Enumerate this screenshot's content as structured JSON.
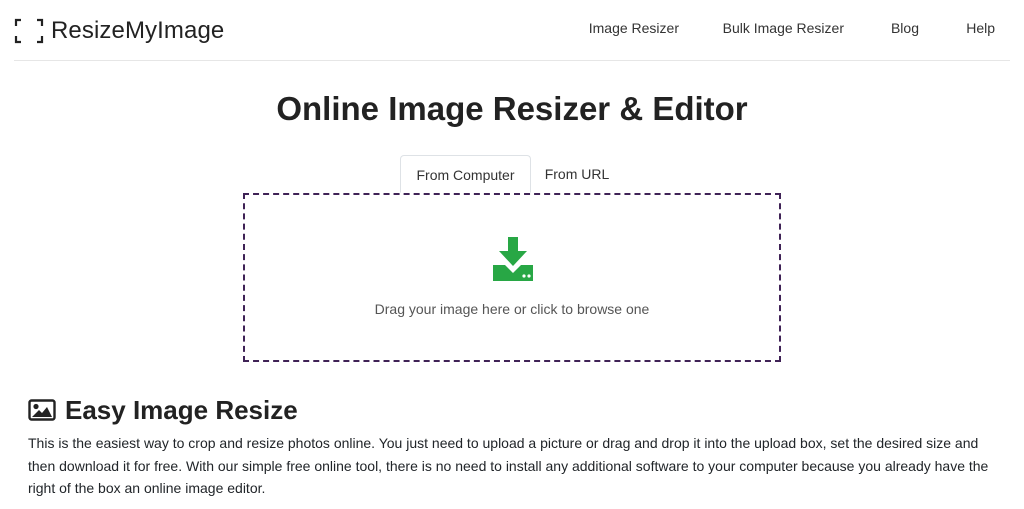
{
  "brand": {
    "name": "ResizeMyImage",
    "icon": "crop-corners-icon"
  },
  "nav": {
    "items": [
      {
        "label": "Image Resizer"
      },
      {
        "label": "Bulk Image Resizer"
      },
      {
        "label": "Blog"
      },
      {
        "label": "Help"
      }
    ]
  },
  "main": {
    "title": "Online Image Resizer & Editor",
    "tabs": [
      {
        "label": "From Computer",
        "active": true
      },
      {
        "label": "From URL",
        "active": false
      }
    ],
    "dropzone": {
      "icon": "download-tray-icon",
      "text": "Drag your image here or click to browse one"
    }
  },
  "section": {
    "icon": "image-icon",
    "title": "Easy Image Resize",
    "body": "This is the easiest way to crop and resize photos online. You just need to upload a picture or drag and drop it into the upload box, set the desired size and then download it for free. With our simple free online tool, there is no need to install any additional software to your computer because you already have the right of the box an online image editor."
  },
  "colors": {
    "accent_green": "#28a745",
    "dropzone_border": "#3f2256",
    "text_dark": "#222222"
  }
}
